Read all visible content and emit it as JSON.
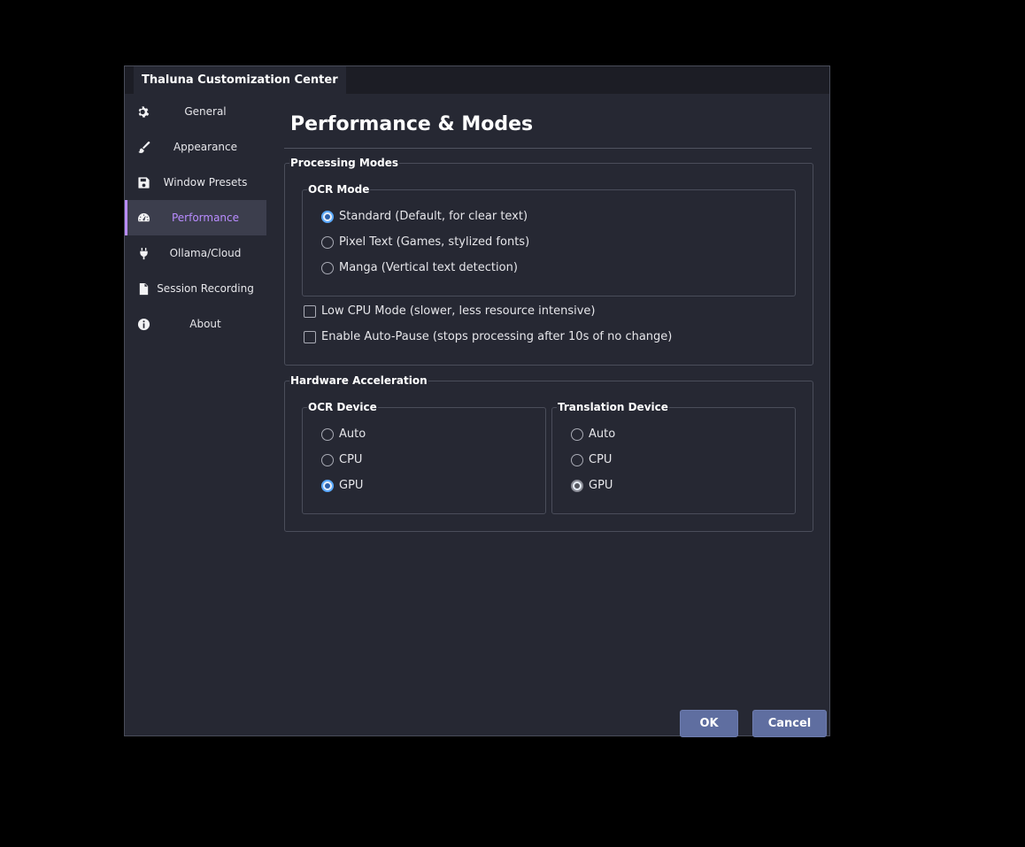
{
  "window": {
    "title": "Thaluna Customization Center"
  },
  "sidebar": {
    "items": [
      {
        "label": "General",
        "icon": "gear-icon"
      },
      {
        "label": "Appearance",
        "icon": "brush-icon"
      },
      {
        "label": "Window Presets",
        "icon": "save-icon"
      },
      {
        "label": "Performance",
        "icon": "gauge-icon",
        "active": true
      },
      {
        "label": "Ollama/Cloud",
        "icon": "plug-icon"
      },
      {
        "label": "Session Recording",
        "icon": "document-icon"
      },
      {
        "label": "About",
        "icon": "info-icon"
      }
    ]
  },
  "page": {
    "title": "Performance & Modes"
  },
  "processing_modes": {
    "title": "Processing Modes",
    "ocr_mode": {
      "title": "OCR Mode",
      "options": [
        {
          "label": "Standard (Default, for clear text)",
          "selected": true
        },
        {
          "label": "Pixel Text (Games, stylized fonts)",
          "selected": false
        },
        {
          "label": "Manga (Vertical text detection)",
          "selected": false
        }
      ]
    },
    "low_cpu": {
      "label": "Low CPU Mode (slower, less resource intensive)",
      "checked": false
    },
    "auto_pause": {
      "label": "Enable Auto-Pause (stops processing after 10s of no change)",
      "checked": false
    }
  },
  "hardware": {
    "title": "Hardware Acceleration",
    "ocr_device": {
      "title": "OCR Device",
      "options": [
        {
          "label": "Auto",
          "selected": false
        },
        {
          "label": "CPU",
          "selected": false
        },
        {
          "label": "GPU",
          "selected": true
        }
      ]
    },
    "translation_device": {
      "title": "Translation Device",
      "options": [
        {
          "label": "Auto",
          "selected": false
        },
        {
          "label": "CPU",
          "selected": false
        },
        {
          "label": "GPU",
          "selected": true
        }
      ]
    }
  },
  "buttons": {
    "ok": "OK",
    "cancel": "Cancel"
  },
  "colors": {
    "accent": "#b98cff",
    "radio_selected": "#5aa9ff",
    "button": "#5f6ea0",
    "background": "#262833"
  }
}
